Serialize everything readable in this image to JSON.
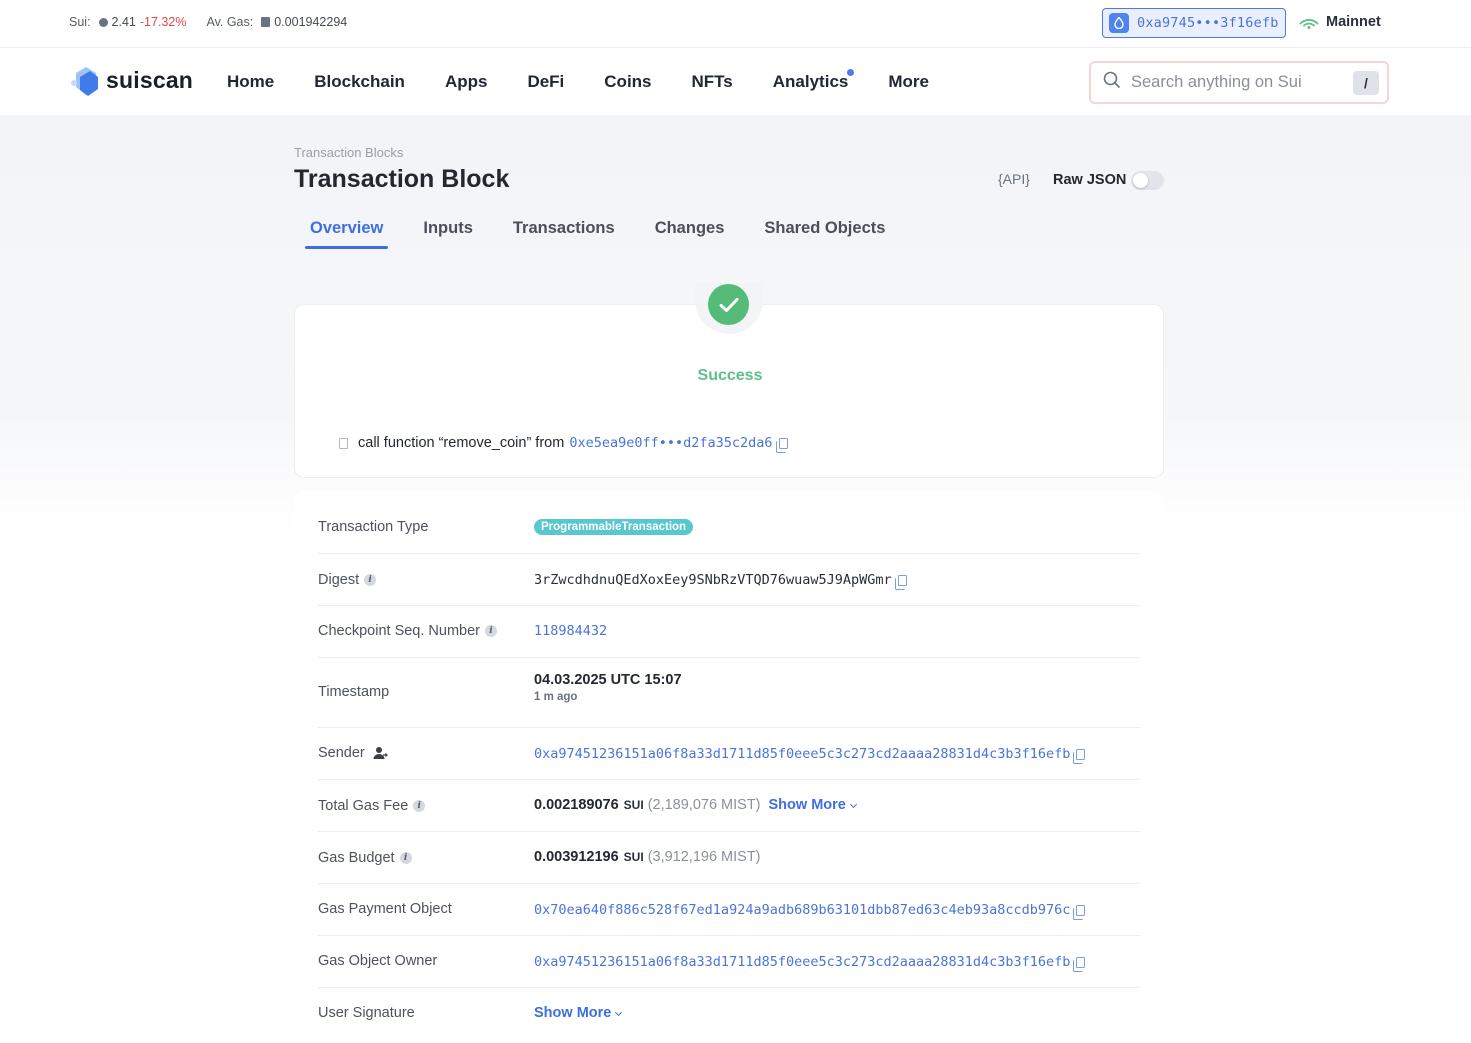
{
  "topbar": {
    "sui_label": "Sui:",
    "sui_price": "2.41",
    "sui_change": "-17.32%",
    "gas_label": "Av. Gas:",
    "gas_value": "0.001942294",
    "wallet_address": "0xa9745•••3f16efb",
    "network": "Mainnet"
  },
  "nav": {
    "logo": "suiscan",
    "items": [
      "Home",
      "Blockchain",
      "Apps",
      "DeFi",
      "Coins",
      "NFTs",
      "Analytics",
      "More"
    ],
    "search_placeholder": "Search anything on Sui",
    "search_shortcut": "/"
  },
  "page": {
    "breadcrumb": "Transaction Blocks",
    "title": "Transaction Block",
    "api_label": "{API}",
    "raw_json_label": "Raw JSON",
    "tabs": [
      "Overview",
      "Inputs",
      "Transactions",
      "Changes",
      "Shared Objects"
    ]
  },
  "status": {
    "label": "Success",
    "call_text": "call function “remove_coin” from",
    "call_address": "0xe5ea9e0ff•••d2fa35c2da6"
  },
  "details": {
    "tx_type": {
      "label": "Transaction Type",
      "value": "ProgrammableTransaction"
    },
    "digest": {
      "label": "Digest",
      "value": "3rZwcdhdnuQEdXoxEey9SNbRzVTQD76wuaw5J9ApWGmr"
    },
    "checkpoint": {
      "label": "Checkpoint Seq. Number",
      "value": "118984432"
    },
    "timestamp": {
      "label": "Timestamp",
      "value": "04.03.2025 UTC 15:07",
      "relative": "1 m ago"
    },
    "sender": {
      "label": "Sender",
      "value": "0xa97451236151a06f8a33d1711d85f0eee5c3c273cd2aaaa28831d4c3b3f16efb"
    },
    "total_gas_fee": {
      "label": "Total Gas Fee",
      "value": "0.002189076",
      "unit": "SUI",
      "mist": "(2,189,076 MIST)",
      "show_more": "Show More"
    },
    "gas_budget": {
      "label": "Gas Budget",
      "value": "0.003912196",
      "unit": "SUI",
      "mist": "(3,912,196 MIST)"
    },
    "gas_payment_object": {
      "label": "Gas Payment Object",
      "value": "0x70ea640f886c528f67ed1a924a9adb689b63101dbb87ed63c4eb93a8ccdb976c"
    },
    "gas_object_owner": {
      "label": "Gas Object Owner",
      "value": "0xa97451236151a06f8a33d1711d85f0eee5c3c273cd2aaaa28831d4c3b3f16efb"
    },
    "user_signature": {
      "label": "User Signature",
      "show_more": "Show More"
    }
  },
  "colors": {
    "accent": "#3e6fe0",
    "success": "#55bb78",
    "negative": "#e04848",
    "badge": "#58c7cf"
  }
}
